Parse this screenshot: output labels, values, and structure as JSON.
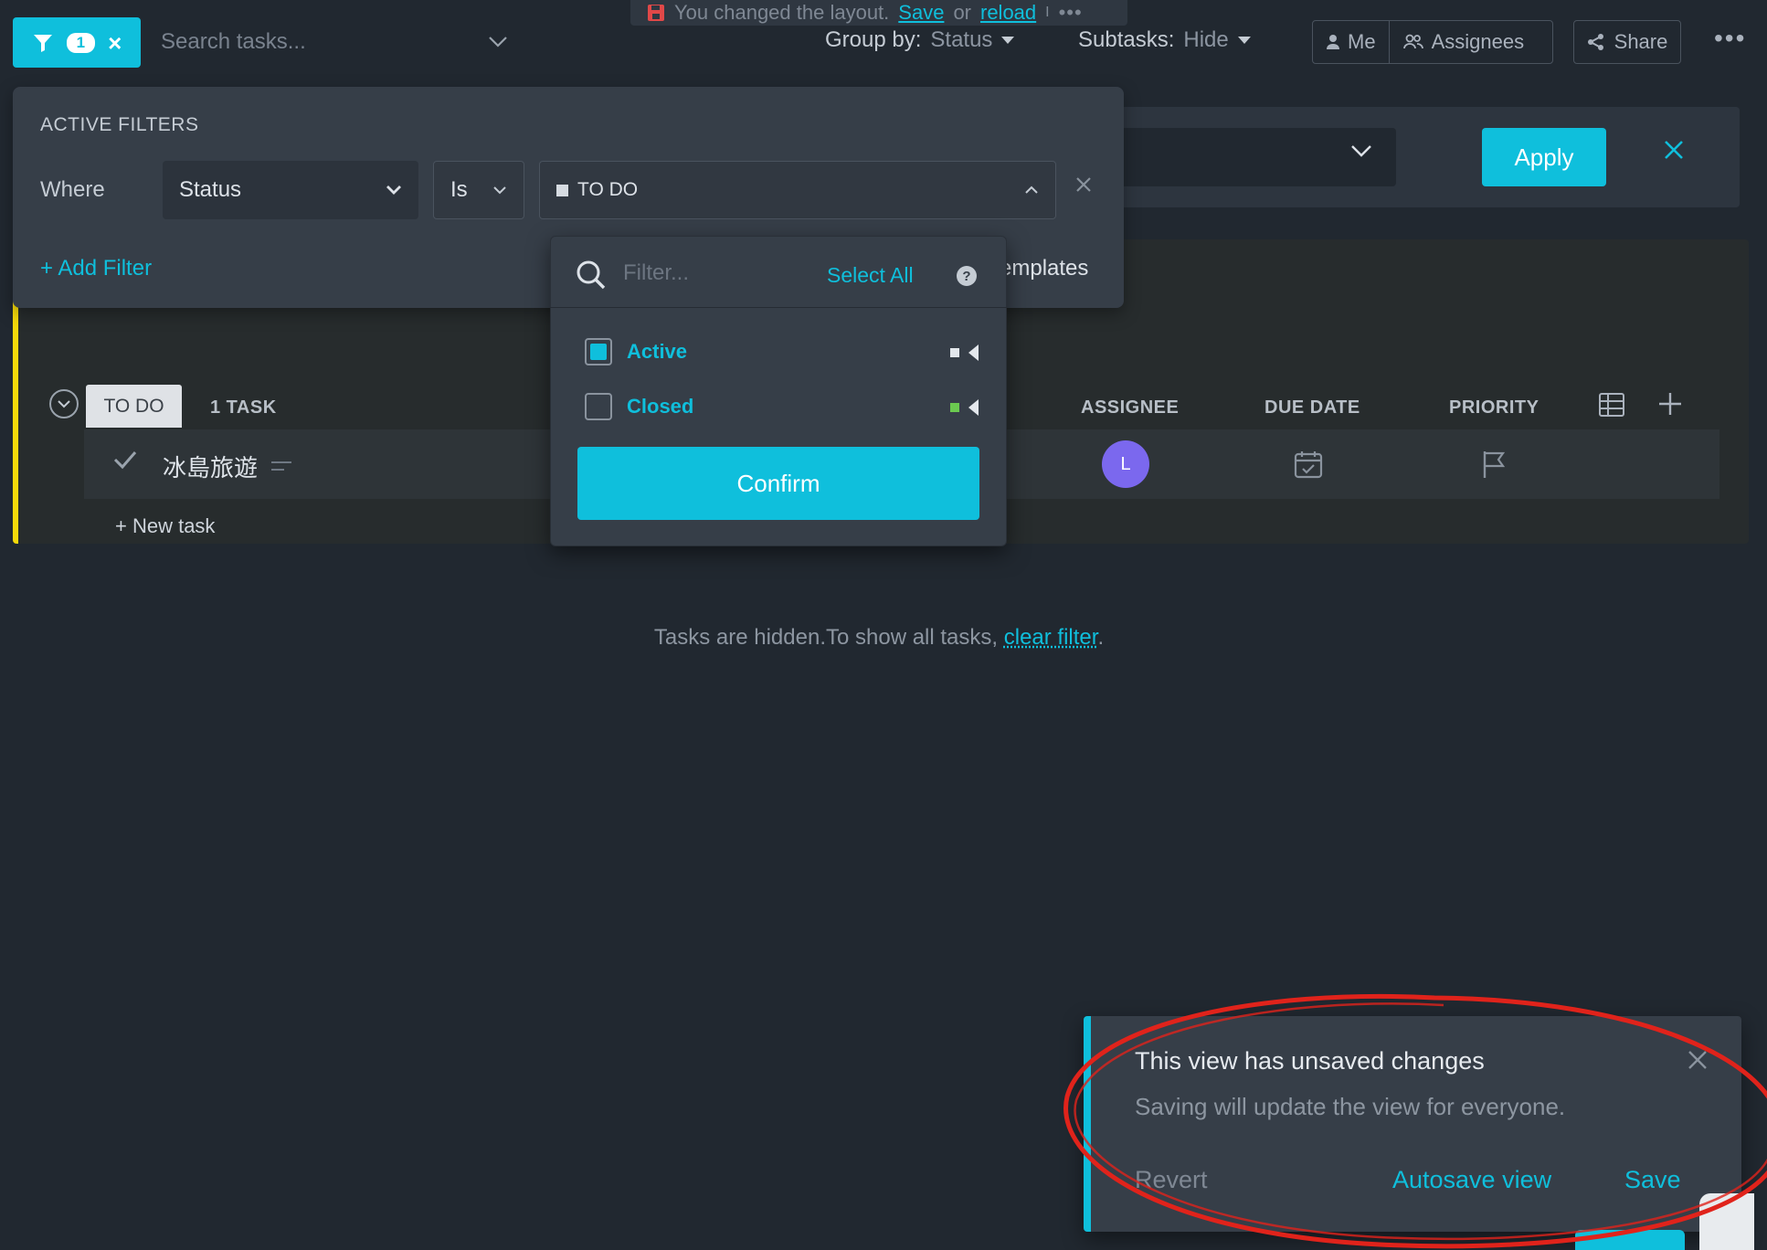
{
  "topbar": {
    "filter_count": "1",
    "search_placeholder": "Search tasks...",
    "banner": {
      "text": "You changed the layout.",
      "save_link": "Save",
      "or": "or",
      "reload_link": "reload",
      "sep": "I"
    },
    "group_by_label": "Group by:",
    "group_by_value": "Status",
    "subtasks_label": "Subtasks:",
    "subtasks_value": "Hide",
    "me_label": "Me",
    "assignees_label": "Assignees",
    "share_label": "Share"
  },
  "apply_bar": {
    "apply_label": "Apply"
  },
  "filters": {
    "title": "ACTIVE FILTERS",
    "where_label": "Where",
    "field_value": "Status",
    "operator_value": "Is",
    "status_value": "TO DO",
    "add_filter_label": "+ Add Filter",
    "templates_label": "emplates"
  },
  "status_dropdown": {
    "filter_placeholder": "Filter...",
    "select_all_label": "Select All",
    "items": [
      {
        "label": "Active",
        "checked": true,
        "color": "#e3e7ec"
      },
      {
        "label": "Closed",
        "checked": false,
        "color": "#6bc950"
      }
    ],
    "confirm_label": "Confirm"
  },
  "list": {
    "status_label": "TO DO",
    "task_count": "1 TASK",
    "columns": {
      "assignee": "ASSIGNEE",
      "due_date": "DUE DATE",
      "priority": "PRIORITY"
    },
    "tasks": [
      {
        "name": "冰島旅遊",
        "assignee_initial": "L"
      }
    ],
    "new_task_label": "+ New task",
    "accent_color": "#f5d90a"
  },
  "hidden_message": {
    "text": "Tasks are hidden.To show all tasks, ",
    "link": "clear filter",
    "end": "."
  },
  "toast": {
    "title": "This view has unsaved changes",
    "subtitle": "Saving will update the view for everyone.",
    "revert_label": "Revert",
    "autosave_label": "Autosave view",
    "save_label": "Save"
  },
  "colors": {
    "accent": "#0fbfdc",
    "background": "#212830",
    "panel": "#363e48",
    "annotation": "#e0231b"
  }
}
